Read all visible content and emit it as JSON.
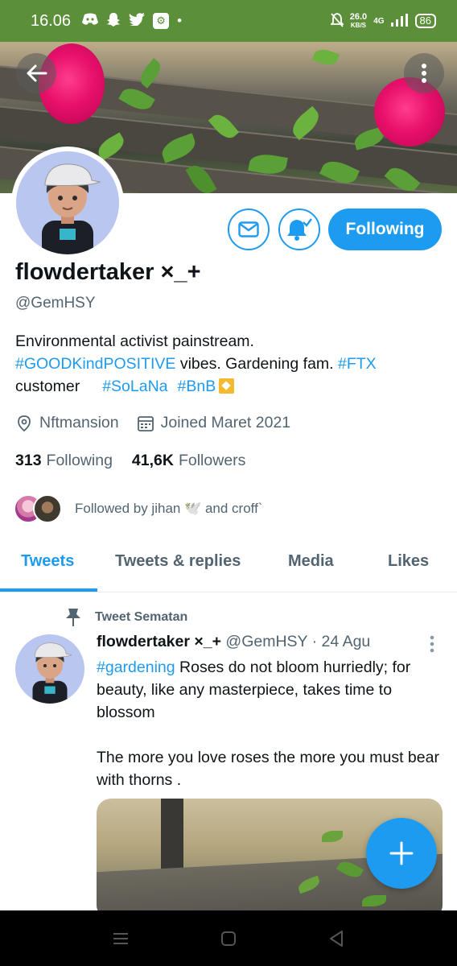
{
  "status_bar": {
    "time": "16.06",
    "net_speed_value": "26.0",
    "net_speed_unit": "KB/S",
    "network": "4G",
    "battery": "86"
  },
  "profile": {
    "display_name": "flowdertaker ×_+",
    "handle": "@GemHSY",
    "bio_line1": "Environmental activist painstream.",
    "bio_tag1": "#GOODKindPOSITIVE",
    "bio_text2": " vibes. Gardening fam. ",
    "bio_tag2": "#FTX",
    "bio_text3": "customer",
    "bio_tag3": "#SoLaNa",
    "bio_tag4": "#BnB",
    "location": "Nftmansion",
    "joined": "Joined Maret 2021",
    "following_count": "313",
    "following_label": "Following",
    "followers_count": "41,6K",
    "followers_label": "Followers",
    "followed_by": "Followed by jihan 🕊️ and croff`",
    "follow_button_label": "Following"
  },
  "tabs": [
    {
      "label": "Tweets",
      "active": true
    },
    {
      "label": "Tweets & replies",
      "active": false
    },
    {
      "label": "Media",
      "active": false
    },
    {
      "label": "Likes",
      "active": false
    }
  ],
  "pinned_tweet": {
    "pin_label": "Tweet Sematan",
    "author_name": "flowdertaker ×_+",
    "author_handle": "@GemHSY",
    "date": " · 24 Agu",
    "tag": "#gardening",
    "text1": " Roses do not bloom hurriedly; for beauty, like any masterpiece, takes time to blossom",
    "text2": "The more you love roses the more you must bear with thorns ."
  },
  "icons": {
    "back": "arrow-left-icon",
    "more": "more-vertical-icon",
    "message": "mail-icon",
    "notifications": "bell-check-icon",
    "location": "location-pin-icon",
    "calendar": "calendar-icon",
    "pin": "pin-icon",
    "compose": "plus-icon"
  },
  "colors": {
    "accent": "#1d9bf0",
    "status_bar": "#5c8f39",
    "secondary_text": "#536471"
  }
}
